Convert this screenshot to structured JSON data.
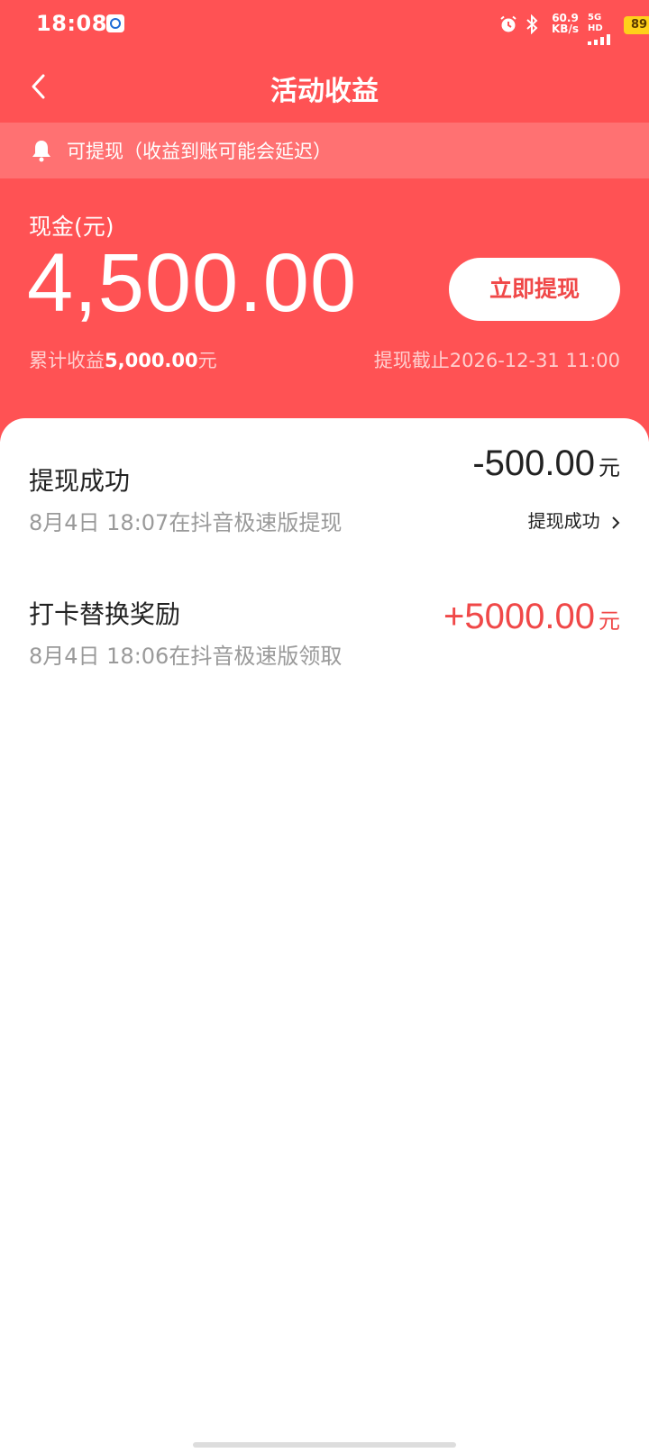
{
  "status_bar": {
    "time": "18:08",
    "speed_value": "60.9",
    "speed_unit": "KB/s",
    "network": "5G HD",
    "battery": "89"
  },
  "header": {
    "title": "活动收益",
    "back_icon": "chevron-left-icon"
  },
  "notice": {
    "icon": "bell-icon",
    "text": "可提现（收益到账可能会延迟）"
  },
  "cash": {
    "label": "现金(元)",
    "amount": "4,500.00",
    "withdraw_button": "立即提现",
    "cumulative_prefix": "累计收益",
    "cumulative_value": "5,000.00",
    "cumulative_suffix": "元",
    "deadline": "提现截止2026-12-31 11:00"
  },
  "records": [
    {
      "title": "提现成功",
      "subtitle": "8月4日 18:07在抖音极速版提现",
      "amount": "-500.00",
      "unit": "元",
      "status": "提现成功"
    },
    {
      "title": "打卡替换奖励",
      "subtitle": "8月4日 18:06在抖音极速版领取",
      "amount": "+5000.00",
      "unit": "元"
    }
  ],
  "colors": {
    "brand_red": "#ff5254",
    "amount_positive": "#f04848",
    "amount_negative": "#222222"
  }
}
